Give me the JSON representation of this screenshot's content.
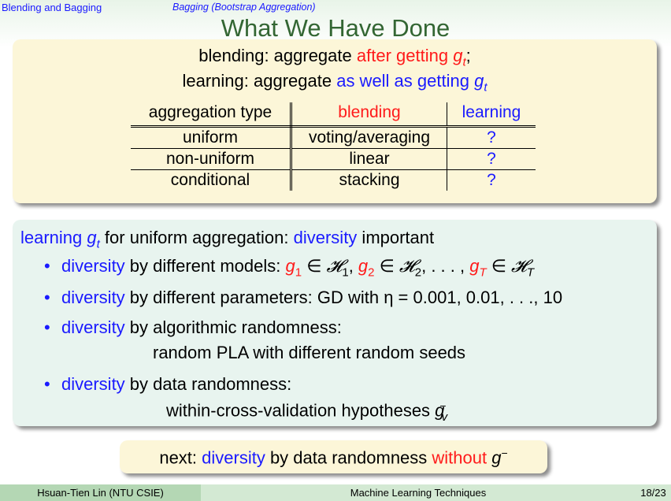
{
  "header": {
    "section": "Blending and Bagging",
    "subsection": "Bagging (Bootstrap Aggregation)",
    "title": "What We Have Done"
  },
  "top_box": {
    "line1_a": "blending: aggregate ",
    "line1_b": "after getting ",
    "line1_g": "g",
    "line1_sub": "t",
    "line1_c": ";",
    "line2_a": "learning: aggregate ",
    "line2_b": "as well as getting ",
    "line2_g": "g",
    "line2_sub": "t",
    "table": {
      "headers": [
        "aggregation type",
        "blending",
        "learning"
      ],
      "rows": [
        [
          "uniform",
          "voting/averaging",
          "?"
        ],
        [
          "non-uniform",
          "linear",
          "?"
        ],
        [
          "conditional",
          "stacking",
          "?"
        ]
      ]
    }
  },
  "mid_box": {
    "head_a": "learning ",
    "head_g": "g",
    "head_sub": "t",
    "head_b": " for uniform aggregation: ",
    "head_c": "diversity",
    "head_d": " important",
    "bullets": [
      {
        "kw": "diversity",
        "rest": " by different models: "
      },
      {
        "kw": "diversity",
        "rest": " by different parameters: GD with ",
        "tail": "η = 0.001, 0.01, . . ., 10"
      },
      {
        "kw": "diversity",
        "rest": " by algorithmic randomness:",
        "sub": "random PLA with different random seeds"
      },
      {
        "kw": "diversity",
        "rest": " by data randomness:",
        "sub": "within-cross-validation hypotheses "
      }
    ]
  },
  "bottom_box": {
    "a": "next: ",
    "b": "diversity",
    "c": " by data randomness ",
    "d": "without ",
    "e": "g"
  },
  "footer": {
    "author": "Hsuan-Tien Lin  (NTU CSIE)",
    "course": "Machine Learning Techniques",
    "page": "18/23"
  },
  "colors": {
    "keyword": "#1a1aff",
    "emphasis": "#ff1a1a",
    "title": "#336633"
  }
}
